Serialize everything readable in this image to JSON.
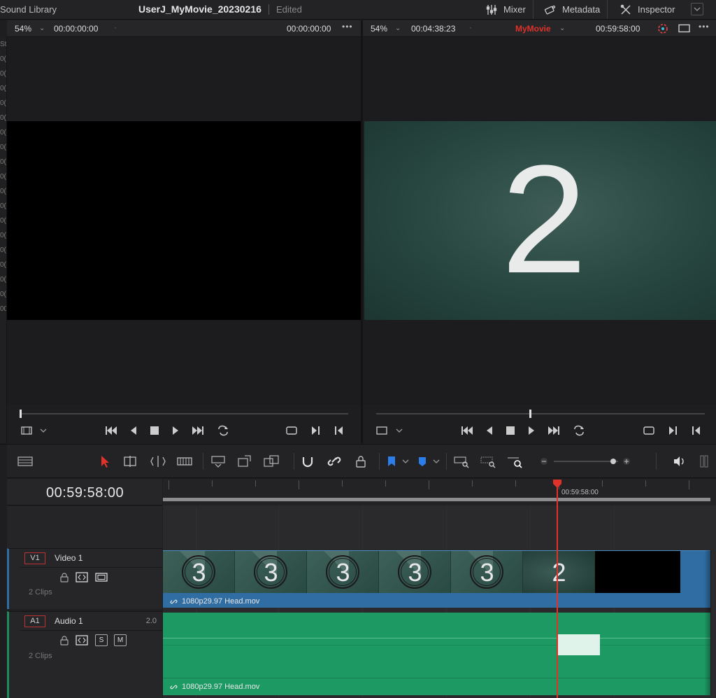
{
  "topbar": {
    "library_label": "Sound Library",
    "project_title": "UserJ_MyMovie_20230216",
    "status": "Edited",
    "mixer_label": "Mixer",
    "metadata_label": "Metadata",
    "inspector_label": "Inspector"
  },
  "source_viewer": {
    "zoom": "54%",
    "timecode_left": "00:00:00:00",
    "timecode_right": "00:00:00:00",
    "scrub_fraction": 0.0
  },
  "program_viewer": {
    "zoom": "54%",
    "duration": "00:04:38:23",
    "timeline_name": "MyMovie",
    "timecode": "00:59:58:00",
    "frame_text": "2",
    "scrub_fraction": 0.47
  },
  "timeline": {
    "timecode": "00:59:58:00",
    "ruler_label": "00:59:58:00",
    "tracks": {
      "v1": {
        "tag": "V1",
        "name": "Video 1",
        "clips": "2 Clips",
        "clip_name": "1080p29.97 Head.mov",
        "thumb_numbers": [
          "3",
          "3",
          "3",
          "3",
          "3",
          "2"
        ]
      },
      "a1": {
        "tag": "A1",
        "name": "Audio 1",
        "channels": "2.0",
        "clips": "2 Clips",
        "clip_name": "1080p29.97 Head.mov",
        "solo": "S",
        "mute": "M"
      }
    }
  },
  "colors": {
    "accent_red": "#e0312b",
    "video_blue": "#2f6da2",
    "audio_green": "#1d9a63"
  },
  "strip_glyphs": [
    "St",
    "0(",
    "0(",
    "0(",
    "0(",
    "0(",
    "0(",
    "0(",
    "0(",
    "0(",
    "0(",
    "0(",
    "0(",
    "0(",
    "0(",
    "0(",
    "0(",
    "0(",
    "00"
  ]
}
